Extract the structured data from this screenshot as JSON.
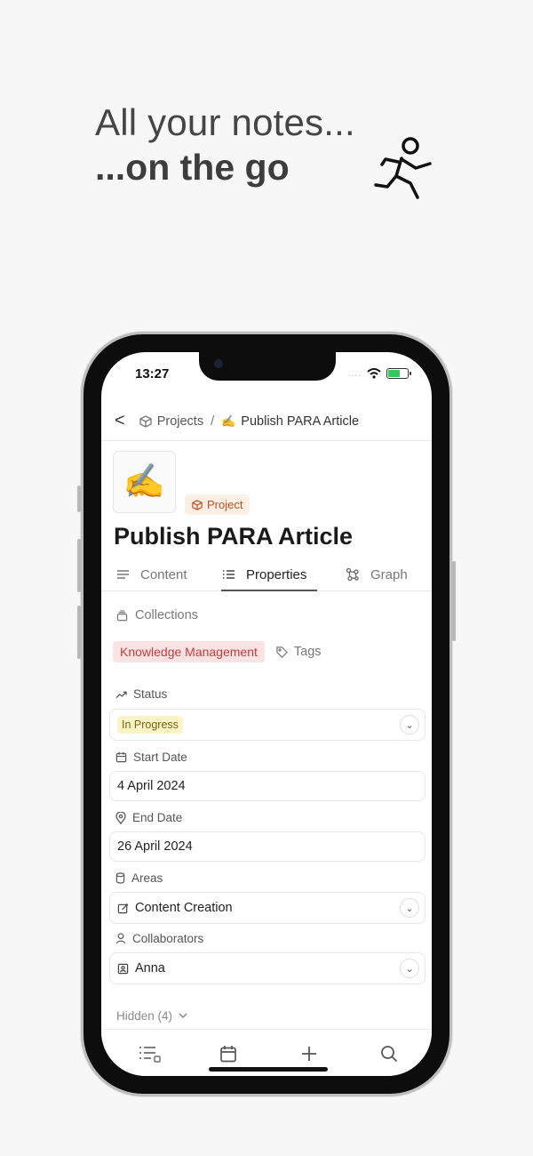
{
  "headline": {
    "line1": "All your notes...",
    "line2": "...on the go"
  },
  "status_bar": {
    "time": "13:27",
    "dots": "...."
  },
  "nav": {
    "back_label": "<",
    "crumb1": "Projects",
    "separator": "/",
    "crumb2": "Publish PARA Article"
  },
  "page": {
    "emoji": "✍️",
    "badge": "Project",
    "title": "Publish PARA Article"
  },
  "tabs": [
    {
      "label": "Content",
      "icon": "lines-icon"
    },
    {
      "label": "Properties",
      "icon": "list-icon"
    },
    {
      "label": "Graph",
      "icon": "graph-icon"
    }
  ],
  "collections": {
    "label": "Collections",
    "tag": "Knowledge Management",
    "tags_label": "Tags"
  },
  "fields": {
    "status": {
      "label": "Status",
      "value": "In Progress"
    },
    "start_date": {
      "label": "Start Date",
      "value": "4 April 2024"
    },
    "end_date": {
      "label": "End Date",
      "value": "26 April 2024"
    },
    "areas": {
      "label": "Areas",
      "value": "Content Creation"
    },
    "collaborators": {
      "label": "Collaborators",
      "value": "Anna"
    }
  },
  "hidden": {
    "label": "Hidden (4)"
  },
  "colors": {
    "accent_orange": "#c04f1f",
    "tag_red": "#c23b3b",
    "status_yellow": "#fcf3c6"
  }
}
